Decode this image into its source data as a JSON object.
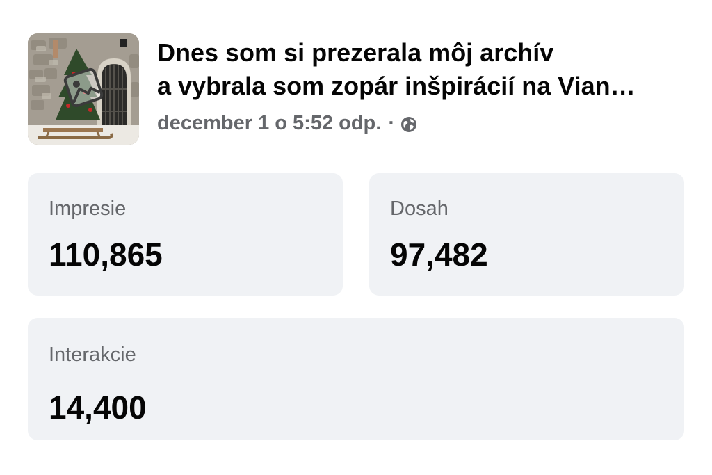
{
  "post": {
    "title_line1": "Dnes som si prezerala môj archív",
    "title_line2": "a vybrala som zopár inšpirácií na Vian…",
    "timestamp": "december 1 o 5:52 odp.",
    "separator": "·",
    "privacy_icon": "globe-icon",
    "thumbnail_overlay_icon": "image-icon"
  },
  "metrics": {
    "impressions": {
      "label": "Impresie",
      "value": "110,865"
    },
    "reach": {
      "label": "Dosah",
      "value": "97,482"
    },
    "engagement": {
      "label": "Interakcie",
      "value": "14,400"
    }
  },
  "colors": {
    "card_background": "#f0f2f5",
    "secondary_text": "#65676b",
    "primary_text": "#050505"
  }
}
